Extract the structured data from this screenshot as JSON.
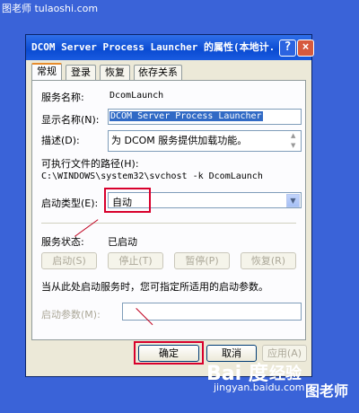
{
  "watermark": {
    "top": "图老师 tulaoshi.com",
    "baidu": "Bai 度",
    "jingyan": "经验",
    "url": "jingyan.baidu.com",
    "logo": "图老师"
  },
  "window": {
    "title": "DCOM Server Process Launcher 的属性(本地计...",
    "help_btn": "?",
    "close_btn": "×"
  },
  "tabs": [
    "常规",
    "登录",
    "恢复",
    "依存关系"
  ],
  "fields": {
    "service_name_label": "服务名称:",
    "service_name_value": "DcomLaunch",
    "display_name_label": "显示名称(N):",
    "display_name_value": "DCOM Server Process Launcher",
    "description_label": "描述(D):",
    "description_value": "为 DCOM 服务提供加载功能。",
    "exe_path_label": "可执行文件的路径(H):",
    "exe_path_value": "C:\\WINDOWS\\system32\\svchost -k DcomLaunch",
    "startup_type_label": "启动类型(E):",
    "startup_type_value": "自动",
    "status_label": "服务状态:",
    "status_value": "已启动",
    "hint": "当从此处启动服务时，您可指定所适用的启动参数。",
    "start_params_label": "启动参数(M):",
    "start_params_value": ""
  },
  "buttons": {
    "start": "启动(S)",
    "stop": "停止(T)",
    "pause": "暂停(P)",
    "resume": "恢复(R)",
    "ok": "确定",
    "cancel": "取消",
    "apply": "应用(A)"
  },
  "colors": {
    "highlight": "#d8002c",
    "title_bar": "#0a4bd2",
    "background": "#3a63d8"
  }
}
